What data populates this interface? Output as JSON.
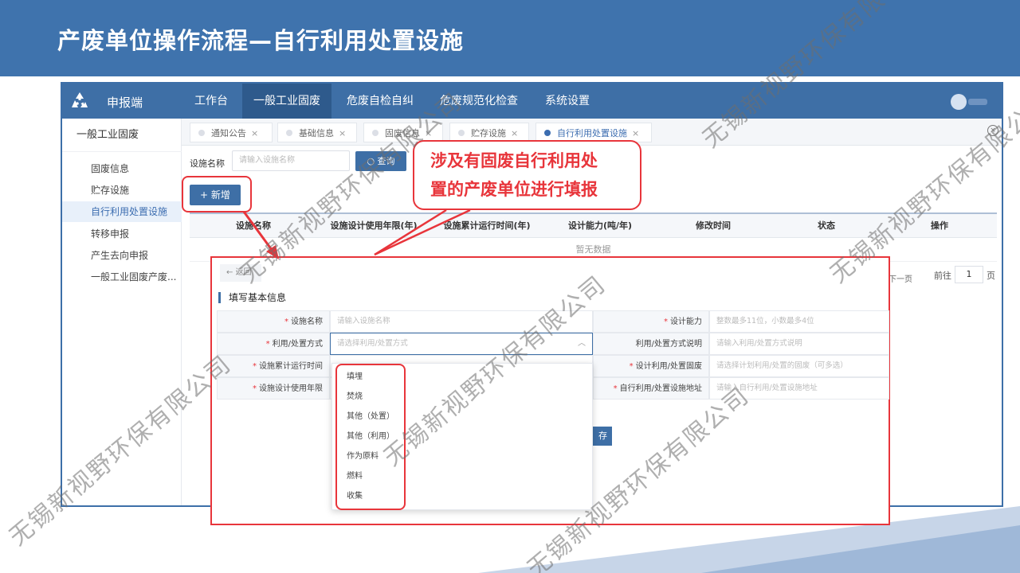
{
  "slide": {
    "title": "产废单位操作流程—自行利用处置设施",
    "watermark": "无锡新视野环保有限公司"
  },
  "app": {
    "brand": "申报端",
    "nav": [
      "工作台",
      "一般工业固废",
      "危废自检自纠",
      "危废规范化检查",
      "系统设置"
    ],
    "sidebar": {
      "header": "一般工业固废",
      "items": [
        "固废信息",
        "贮存设施",
        "自行利用处置设施",
        "转移申报",
        "产生去向申报",
        "一般工业固废产废..."
      ]
    },
    "tabs": [
      "通知公告",
      "基础信息",
      "固废信息",
      "贮存设施",
      "自行利用处置设施"
    ],
    "tab_close": "×",
    "filter": {
      "label": "设施名称",
      "placeholder": "请输入设施名称",
      "query_label": "查询"
    },
    "add_label": "新增",
    "table": {
      "headers": [
        "设施名称",
        "设施设计使用年限(年)",
        "设施累计运行时间(年)",
        "设计能力(吨/年)",
        "修改时间",
        "状态",
        "操作"
      ],
      "empty": "暂无数据"
    },
    "pager": {
      "next": "下一页",
      "goto": "前往",
      "page": "1",
      "unit": "页"
    }
  },
  "callout": {
    "line1": "涉及有固废自行利用处",
    "line2": "置的产废单位进行填报"
  },
  "form": {
    "back": "返回",
    "section": "填写基本信息",
    "req_mark": "*",
    "rows": [
      {
        "l1": "设施名称",
        "p1": "请输入设施名称",
        "l2": "设计能力",
        "p2": "整数最多11位，小数最多4位"
      },
      {
        "l1": "利用/处置方式",
        "p1": "请选择利用/处置方式",
        "l2": "利用/处置方式说明",
        "p2": "请输入利用/处置方式说明"
      },
      {
        "l1": "设施累计运行时间",
        "p1": "",
        "l2": "设计利用/处置固废",
        "p2": "请选择计划利用/处置的固废（可多选）"
      },
      {
        "l1": "设施设计使用年限",
        "p1": "",
        "l2": "自行利用/处置设施地址",
        "p2": "请输入自行利用/处置设施地址"
      }
    ],
    "dropdown_options": [
      "填埋",
      "焚烧",
      "其他（处置）",
      "其他（利用）",
      "作为原料",
      "燃料",
      "收集"
    ],
    "save_label": "存"
  }
}
